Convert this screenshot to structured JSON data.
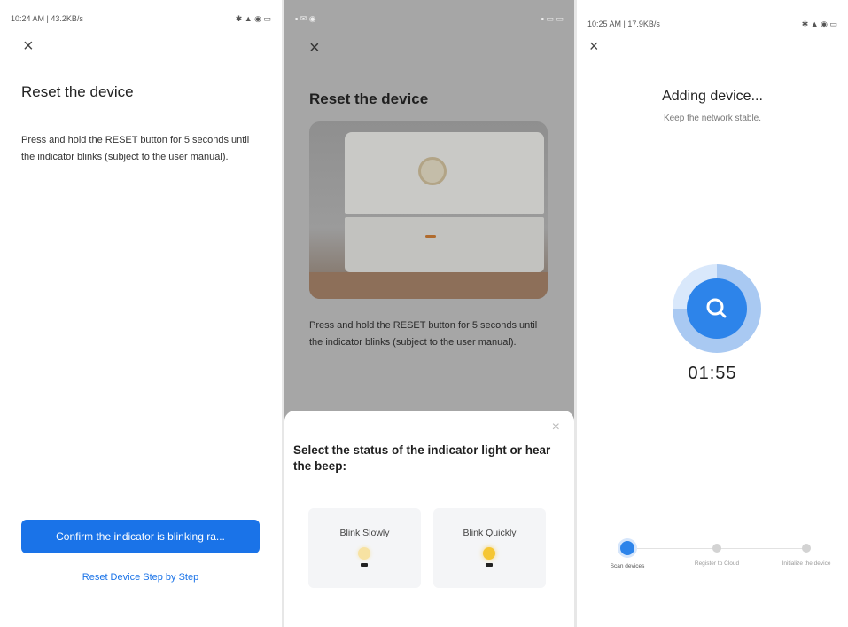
{
  "screen1": {
    "status_time": "10:24 AM | 43.2KB/s",
    "status_icons": "✱ ▲ ◉ ▭",
    "close_glyph": "×",
    "title": "Reset the device",
    "body": "Press and hold the RESET button for 5 seconds until the indicator blinks (subject to the user manual).",
    "confirm_button": "Confirm the indicator is blinking ra...",
    "link": "Reset Device Step by Step"
  },
  "screen2": {
    "status_left": "▪ ✉ ◉",
    "status_right": "▪ ▭ ▭",
    "close_glyph": "×",
    "title": "Reset the device",
    "body": "Press and hold the RESET button for 5 seconds until the indicator blinks (subject to the user manual).",
    "sheet": {
      "close_glyph": "×",
      "title": "Select the status of the indicator light or hear the beep:",
      "options": [
        {
          "label": "Blink Slowly",
          "icon": "bulb-dim-icon"
        },
        {
          "label": "Blink Quickly",
          "icon": "bulb-bright-icon"
        }
      ]
    }
  },
  "screen3": {
    "status_time": "10:25 AM | 17.9KB/s",
    "status_icons": "✱ ▲ ◉ ▭",
    "close_glyph": "×",
    "title": "Adding device...",
    "subtitle": "Keep the network stable.",
    "timer": "01:55",
    "steps": [
      {
        "label": "Scan devices",
        "active": true
      },
      {
        "label": "Register to Cloud",
        "active": false
      },
      {
        "label": "Initialize the device",
        "active": false
      }
    ]
  },
  "colors": {
    "accent": "#1a73e8",
    "progress": "#2d84ea",
    "overlay": "#a6a6a6"
  }
}
